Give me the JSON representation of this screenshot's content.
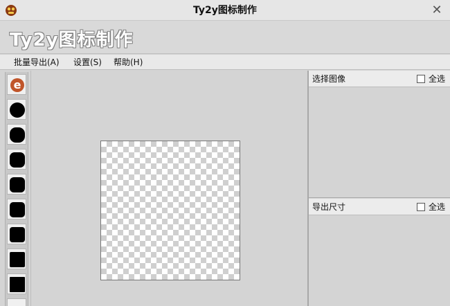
{
  "window": {
    "title": "Ty2y图标制作",
    "close_glyph": "✕"
  },
  "banner": {
    "text": "Ty2y图标制作"
  },
  "menu": [
    {
      "label": "批量导出(A)"
    },
    {
      "label": "设置(S)"
    },
    {
      "label": "帮助(H)"
    }
  ],
  "icons": [
    {
      "name": "ie-e-icon",
      "letter": "e"
    },
    {
      "name": "circle-icon"
    },
    {
      "name": "rounded-square-icon"
    },
    {
      "name": "rounded-square-icon"
    },
    {
      "name": "rounded-square-icon"
    },
    {
      "name": "rounded-square-icon"
    },
    {
      "name": "rounded-square-icon"
    },
    {
      "name": "square-icon"
    },
    {
      "name": "square-icon"
    }
  ],
  "panels": {
    "select_image": {
      "title": "选择图像",
      "select_all": "全选"
    },
    "export_size": {
      "title": "导出尺寸",
      "select_all": "全选"
    }
  },
  "colors": {
    "ie_icon": "#c0552a",
    "background": "#d4d4d4"
  }
}
